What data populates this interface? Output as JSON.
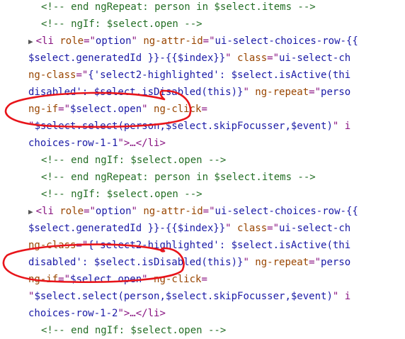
{
  "colors": {
    "comment": "#236e25",
    "tag": "#881280",
    "attr_name": "#994500",
    "attr_value": "#1a1aa6",
    "punct": "#881280",
    "annotation": "#e8141a"
  },
  "lines": [
    {
      "segments": [
        {
          "t": "<!-- end ngRepeat: person in $select.items -->",
          "c": "c"
        }
      ]
    },
    {
      "segments": [
        {
          "t": "<!-- ngIf: $select.open -->",
          "c": "c"
        }
      ]
    },
    {
      "toggle": "▶",
      "segments": [
        {
          "t": "<li ",
          "c": "t"
        },
        {
          "t": "role",
          "c": "a"
        },
        {
          "t": "=\"",
          "c": "p"
        },
        {
          "t": "option",
          "c": "v"
        },
        {
          "t": "\" ",
          "c": "p"
        },
        {
          "t": "ng-attr-id",
          "c": "a"
        },
        {
          "t": "=\"",
          "c": "p"
        },
        {
          "t": "ui-select-choices-row-{{",
          "c": "v"
        }
      ]
    },
    {
      "segments": [
        {
          "t": "$select.generatedId }}-{{$index}}",
          "c": "v"
        },
        {
          "t": "\" ",
          "c": "p"
        },
        {
          "t": "class",
          "c": "a"
        },
        {
          "t": "=\"",
          "c": "p"
        },
        {
          "t": "ui-select-ch",
          "c": "v"
        }
      ]
    },
    {
      "segments": [
        {
          "t": "ng-class",
          "c": "a"
        },
        {
          "t": "=\"",
          "c": "p"
        },
        {
          "t": "{'select2-highlighted': $select.isActive(thi",
          "c": "v"
        }
      ]
    },
    {
      "segments": [
        {
          "t": "disabled': $select.isDisabled(this)}",
          "c": "v"
        },
        {
          "t": "\" ",
          "c": "p"
        },
        {
          "t": "ng-repeat",
          "c": "a"
        },
        {
          "t": "=\"",
          "c": "p"
        },
        {
          "t": "perso",
          "c": "v"
        }
      ]
    },
    {
      "segments": [
        {
          "t": "ng-if",
          "c": "a"
        },
        {
          "t": "=\"",
          "c": "p"
        },
        {
          "t": "$select.open",
          "c": "v"
        },
        {
          "t": "\" ",
          "c": "p"
        },
        {
          "t": "ng-click",
          "c": "a"
        },
        {
          "t": "=",
          "c": "p"
        }
      ]
    },
    {
      "segments": [
        {
          "t": "\"",
          "c": "p"
        },
        {
          "t": "$select.select(person,$select.skipFocusser,$event)",
          "c": "v"
        },
        {
          "t": "\" i",
          "c": "p"
        }
      ]
    },
    {
      "segments": [
        {
          "t": "choices-row-1-1",
          "c": "v"
        },
        {
          "t": "\">…</li>",
          "c": "t"
        }
      ]
    },
    {
      "segments": [
        {
          "t": "<!-- end ngIf: $select.open -->",
          "c": "c"
        }
      ]
    },
    {
      "segments": [
        {
          "t": "<!-- end ngRepeat: person in $select.items -->",
          "c": "c"
        }
      ]
    },
    {
      "segments": [
        {
          "t": "<!-- ngIf: $select.open -->",
          "c": "c"
        }
      ]
    },
    {
      "toggle": "▶",
      "segments": [
        {
          "t": "<li ",
          "c": "t"
        },
        {
          "t": "role",
          "c": "a"
        },
        {
          "t": "=\"",
          "c": "p"
        },
        {
          "t": "option",
          "c": "v"
        },
        {
          "t": "\" ",
          "c": "p"
        },
        {
          "t": "ng-attr-id",
          "c": "a"
        },
        {
          "t": "=\"",
          "c": "p"
        },
        {
          "t": "ui-select-choices-row-{{",
          "c": "v"
        }
      ]
    },
    {
      "segments": [
        {
          "t": "$select.generatedId }}-{{$index}}",
          "c": "v"
        },
        {
          "t": "\" ",
          "c": "p"
        },
        {
          "t": "class",
          "c": "a"
        },
        {
          "t": "=\"",
          "c": "p"
        },
        {
          "t": "ui-select-ch",
          "c": "v"
        }
      ]
    },
    {
      "segments": [
        {
          "t": "ng-class",
          "c": "a"
        },
        {
          "t": "=\"",
          "c": "p"
        },
        {
          "t": "{'select2-highlighted': $select.isActive(thi",
          "c": "v"
        }
      ]
    },
    {
      "segments": [
        {
          "t": "disabled': $select.isDisabled(this)}",
          "c": "v"
        },
        {
          "t": "\" ",
          "c": "p"
        },
        {
          "t": "ng-repeat",
          "c": "a"
        },
        {
          "t": "=\"",
          "c": "p"
        },
        {
          "t": "perso",
          "c": "v"
        }
      ]
    },
    {
      "segments": [
        {
          "t": "ng-if",
          "c": "a"
        },
        {
          "t": "=\"",
          "c": "p"
        },
        {
          "t": "$select.open",
          "c": "v"
        },
        {
          "t": "\" ",
          "c": "p"
        },
        {
          "t": "ng-click",
          "c": "a"
        },
        {
          "t": "=",
          "c": "p"
        }
      ]
    },
    {
      "segments": [
        {
          "t": "\"",
          "c": "p"
        },
        {
          "t": "$select.select(person,$select.skipFocusser,$event)",
          "c": "v"
        },
        {
          "t": "\" i",
          "c": "p"
        }
      ]
    },
    {
      "segments": [
        {
          "t": "choices-row-1-2",
          "c": "v"
        },
        {
          "t": "\">…</li>",
          "c": "t"
        }
      ]
    },
    {
      "segments": [
        {
          "t": "<!-- end ngIf: $select.open -->",
          "c": "c"
        }
      ]
    }
  ]
}
